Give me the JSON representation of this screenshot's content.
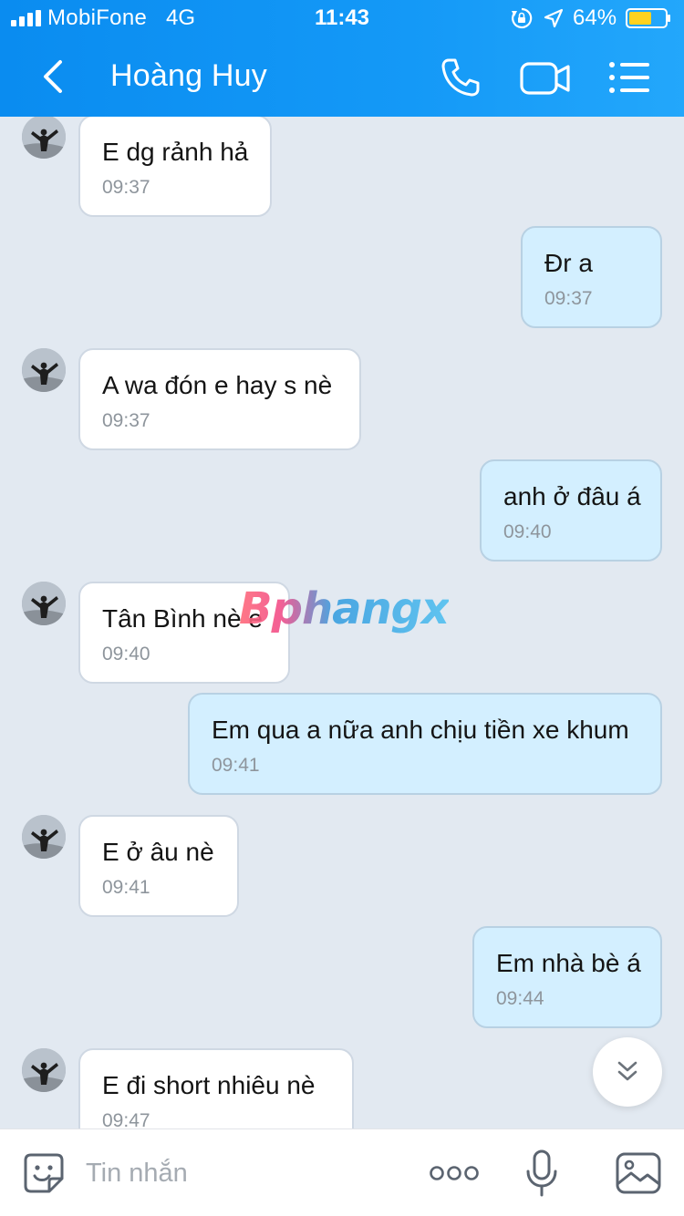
{
  "status_bar": {
    "carrier": "MobiFone",
    "network": "4G",
    "time": "11:43",
    "battery_percent": "64%",
    "battery_level": 0.64,
    "signal_bars": 4
  },
  "header": {
    "title": "Hoàng Huy",
    "icons": [
      "back-chevron-icon",
      "phone-icon",
      "video-camera-icon",
      "list-menu-icon"
    ]
  },
  "messages": [
    {
      "direction": "incoming",
      "text": "E dg rảnh hả",
      "time": "09:37"
    },
    {
      "direction": "outgoing",
      "text": "Đr a",
      "time": "09:37"
    },
    {
      "direction": "incoming",
      "text": "A wa đón e hay s nè",
      "time": "09:37"
    },
    {
      "direction": "outgoing",
      "text": "anh ở đâu á",
      "time": "09:40"
    },
    {
      "direction": "incoming",
      "text": "Tân Bình nè e",
      "time": "09:40"
    },
    {
      "direction": "outgoing",
      "text": "Em qua a nữa anh chịu tiền xe khum",
      "time": "09:41"
    },
    {
      "direction": "incoming",
      "text": "E ở âu nè",
      "time": "09:41"
    },
    {
      "direction": "outgoing",
      "text": "Em nhà bè á",
      "time": "09:44"
    },
    {
      "direction": "incoming",
      "text": "E đi short nhiêu nè",
      "time": "09:47"
    }
  ],
  "watermark": "Bphangx",
  "input_bar": {
    "placeholder": "Tin nhắn",
    "icons": [
      "emoji-sticker-icon",
      "more-dots-icon",
      "microphone-icon",
      "image-icon"
    ]
  },
  "colors": {
    "header_gradient_start": "#0a8cf0",
    "header_gradient_end": "#23a7fb",
    "chat_background": "#e2e9f1",
    "incoming_bubble": "#ffffff",
    "outgoing_bubble": "#d3efff",
    "timestamp": "#8e959c"
  }
}
